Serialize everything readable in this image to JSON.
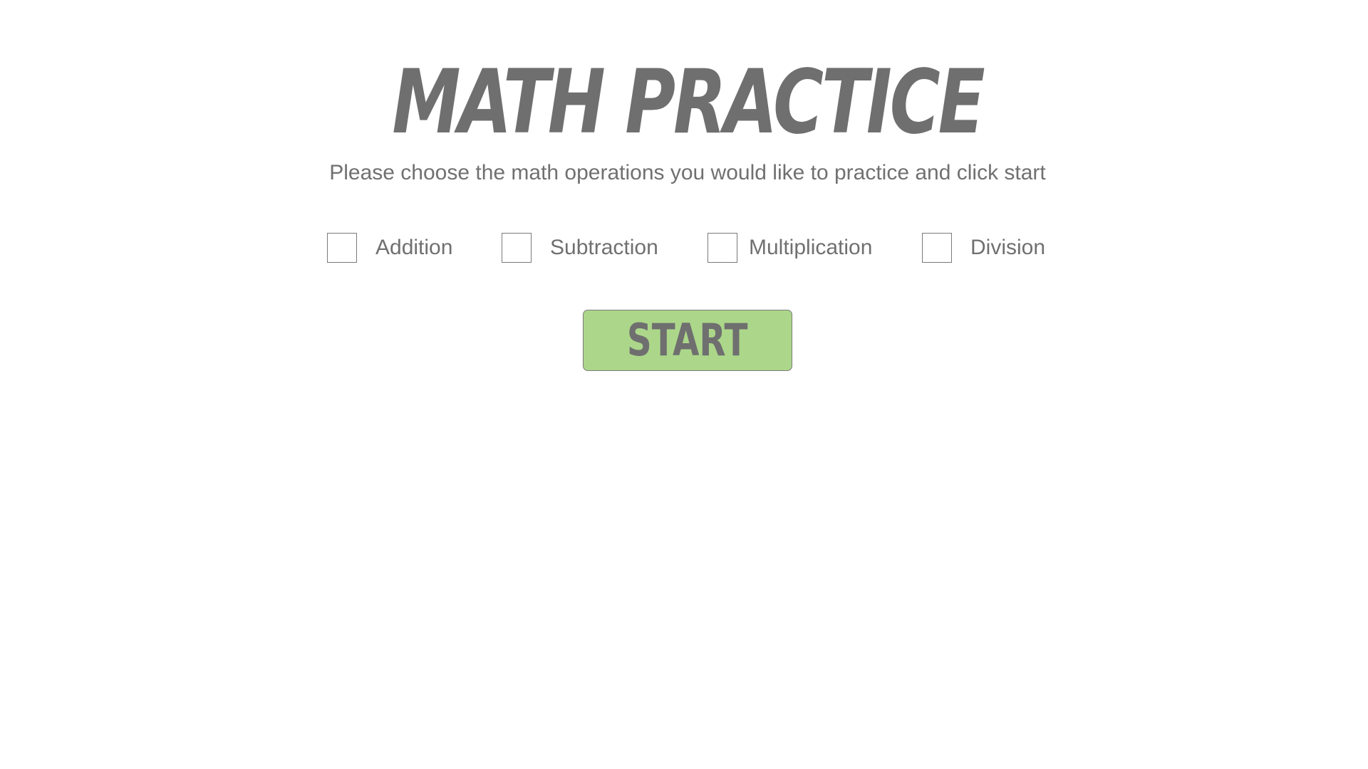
{
  "page": {
    "title": "MATH PRACTICE",
    "subtitle": "Please choose the math operations you would like to practice and click start"
  },
  "operations": [
    {
      "label": "Addition",
      "checked": false
    },
    {
      "label": "Subtraction",
      "checked": false
    },
    {
      "label": "Multiplication",
      "checked": false
    },
    {
      "label": "Division",
      "checked": false
    }
  ],
  "start_button": {
    "label": "START"
  },
  "colors": {
    "text": "#707070",
    "start_button_background": "#acd78a",
    "border": "#7a7a7a",
    "background": "#ffffff"
  }
}
